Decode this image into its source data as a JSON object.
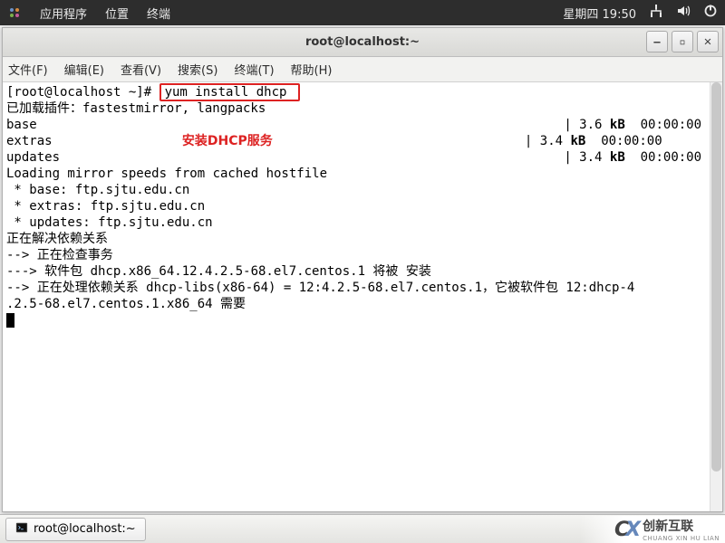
{
  "panel": {
    "apps": "应用程序",
    "places": "位置",
    "terminal": "终端",
    "clock": "星期四 19:50"
  },
  "window": {
    "title": "root@localhost:~"
  },
  "menubar": {
    "file": "文件(F)",
    "edit": "编辑(E)",
    "view": "查看(V)",
    "search": "搜索(S)",
    "terminal": "终端(T)",
    "help": "帮助(H)"
  },
  "term": {
    "prompt": "[root@localhost ~]# ",
    "cmd": "yum install dhcp ",
    "l2": "已加载插件：fastestmirror, langpacks",
    "l3a": "base",
    "l3b": "| 3.6 ",
    "l3c": "kB",
    "l3d": "  00:00:00",
    "l4a": "extras",
    "ann": "安装DHCP服务",
    "l4b": "| 3.4 ",
    "l4c": "kB",
    "l4d": "  00:00:00",
    "l5a": "updates",
    "l5b": "| 3.4 ",
    "l5c": "kB",
    "l5d": "  00:00:00",
    "l6": "Loading mirror speeds from cached hostfile",
    "l7": " * base: ftp.sjtu.edu.cn",
    "l8": " * extras: ftp.sjtu.edu.cn",
    "l9": " * updates: ftp.sjtu.edu.cn",
    "l10": "正在解决依赖关系",
    "l11": "--> 正在检查事务",
    "l12": "---> 软件包 dhcp.x86_64.12.4.2.5-68.el7.centos.1 将被 安装",
    "l13": "--> 正在处理依赖关系 dhcp-libs(x86-64) = 12:4.2.5-68.el7.centos.1，它被软件包 12:dhcp-4",
    "l14": ".2.5-68.el7.centos.1.x86_64 需要"
  },
  "taskbar": {
    "item": "root@localhost:~"
  },
  "watermark": {
    "brand_cn": "创新互联",
    "brand_py": "CHUANG XIN HU LIAN"
  }
}
